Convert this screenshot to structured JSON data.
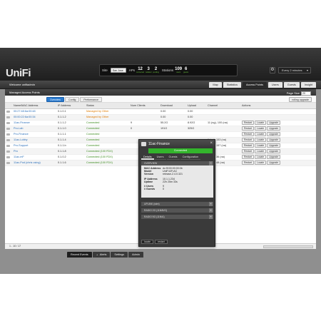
{
  "header": {
    "logo": "UniFi",
    "site_label": "Site",
    "site_value": "San Jose",
    "aps_label": "APs",
    "aps_count": "12",
    "aps_sub": "connected",
    "disconnected_count": "3",
    "disconnected_sub": "isolated",
    "pending_count": "2",
    "pending_sub": "pending",
    "stations_label": "Stations",
    "stations_count": "109",
    "stations_sub": "users",
    "guests_count": "6",
    "guests_sub": "guests",
    "refresh_value": "Every 2 minutes"
  },
  "subbar": {
    "welcome": "Welcome unifiadmin",
    "tabs": [
      {
        "label": "Map",
        "active": false
      },
      {
        "label": "Statistics",
        "active": false
      },
      {
        "label": "Access Points",
        "active": true
      },
      {
        "label": "Users",
        "active": false
      },
      {
        "label": "Guests",
        "active": false
      },
      {
        "label": "Insight",
        "active": false
      }
    ]
  },
  "panel": {
    "title": "Managed Access Points",
    "page_size_label": "Page Size",
    "page_size_value": "20",
    "subtabs": [
      "Overview",
      "Config",
      "Performance"
    ],
    "rolling_upgrade": "rolling upgrade",
    "columns": [
      "",
      "Name/MAC Address",
      "IP Address",
      "Status",
      "Num Clients",
      "Download",
      "Upload",
      "Channel",
      "Actions"
    ],
    "rows": [
      {
        "name": "00:27:48:6a:00:48",
        "ip": "0.1.0.1",
        "status": "Managed by Other",
        "status_type": "orange",
        "clients": "",
        "download": "0.00",
        "upload": "0.00",
        "channel": "",
        "buttons": []
      },
      {
        "name": "00:00:22:6a:00:34",
        "ip": "0.1.1.2",
        "status": "Managed by Other",
        "status_type": "orange",
        "clients": "",
        "download": "0.00",
        "upload": "0.00",
        "channel": "",
        "buttons": []
      },
      {
        "name": "11ac-Finance",
        "ip": "0.1.1.2",
        "status": "Connected",
        "status_type": "green",
        "clients": "9",
        "download": "55.2G",
        "upload": "8.92G",
        "channel": "11 (ng), 100 (na)",
        "buttons": [
          "Restart",
          "Locate",
          "Upgrade"
        ]
      },
      {
        "name": "Pro-Lab",
        "ip": "0.1.1.0",
        "status": "Connected",
        "status_type": "green",
        "clients": "0",
        "download": "191G",
        "upload": "325G",
        "channel": "",
        "buttons": [
          "Restart",
          "Locate",
          "Upgrade"
        ]
      },
      {
        "name": "Pro-Finance",
        "ip": "0.1.1.1",
        "status": "Connected",
        "status_type": "green",
        "clients": "",
        "download": "",
        "upload": "",
        "channel": "",
        "buttons": [
          "Restart",
          "Locate",
          "Upgrade"
        ]
      },
      {
        "name": "11ac-Lobby",
        "ip": "0.1.1.4",
        "status": "Connected",
        "status_type": "green",
        "clients": "",
        "download": "",
        "upload": "",
        "channel": "1 (ng), 153 (na)",
        "buttons": [
          "Restart",
          "Locate",
          "Upgrade"
        ]
      },
      {
        "name": "Pro-Support",
        "ip": "0.1.1.b",
        "status": "Connected",
        "status_type": "green",
        "clients": "",
        "download": "",
        "upload": "",
        "channel": "6 (ng), 157 (na)",
        "buttons": [
          "Restart",
          "Locate",
          "Upgrade"
        ]
      },
      {
        "name": "Pro",
        "ip": "0.1.1.8",
        "status": "Connected (100 FDX)",
        "status_type": "green",
        "clients": "",
        "download": "",
        "upload": "",
        "channel": "",
        "buttons": [
          "Restart",
          "Locate",
          "Upgrade"
        ]
      },
      {
        "name": "11ac-mF",
        "ip": "0.1.0.2",
        "status": "Connected (100 FDX)",
        "status_type": "green",
        "clients": "",
        "download": "",
        "upload": "",
        "channel": "1 (ng), 36 (na)",
        "buttons": [
          "Restart",
          "Locate",
          "Upgrade"
        ]
      },
      {
        "name": "11ac-Pod (chris using)",
        "ip": "0.1.1.6",
        "status": "Connected (100 FDX)",
        "status_type": "green",
        "clients": "",
        "download": "",
        "upload": "",
        "channel": "6 (ng), 48 (na)",
        "buttons": [
          "Restart",
          "Locate",
          "Upgrade"
        ]
      }
    ],
    "pager": "1 - 10 / 17"
  },
  "bottom_tabs": [
    {
      "label": "Recent Events",
      "active": true
    },
    {
      "label": "Alerts",
      "active": false
    },
    {
      "label": "Settings",
      "active": false
    },
    {
      "label": "Admin",
      "active": false
    }
  ],
  "popup": {
    "title": "11ac-Finance",
    "status": "Connected",
    "tabs": [
      "Details",
      "Users",
      "Guests",
      "Configuration"
    ],
    "overview_label": "OVERVIEW",
    "mac_label": "MAC Address",
    "mac_value": "dc:9f:00:00:00:0b",
    "model_label": "Model",
    "model_value": "UniFi AP-AC",
    "version_label": "Version",
    "version_value": "release-2.4.0.321",
    "ip_label": "IP Address",
    "ip_value": "10.1.1.234",
    "uptime_label": "Uptime",
    "uptime_value": "22h 25m 33s",
    "users_label": "# Users",
    "users_value": "9",
    "guests_label": "# Guests",
    "guests_value": "0",
    "sections": [
      "UPLINK (wire)",
      "RADIO 2G (11N/B/G)",
      "RADIO 5G (11N/A)"
    ],
    "locate_btn": "locate",
    "restart_btn": "restart"
  }
}
